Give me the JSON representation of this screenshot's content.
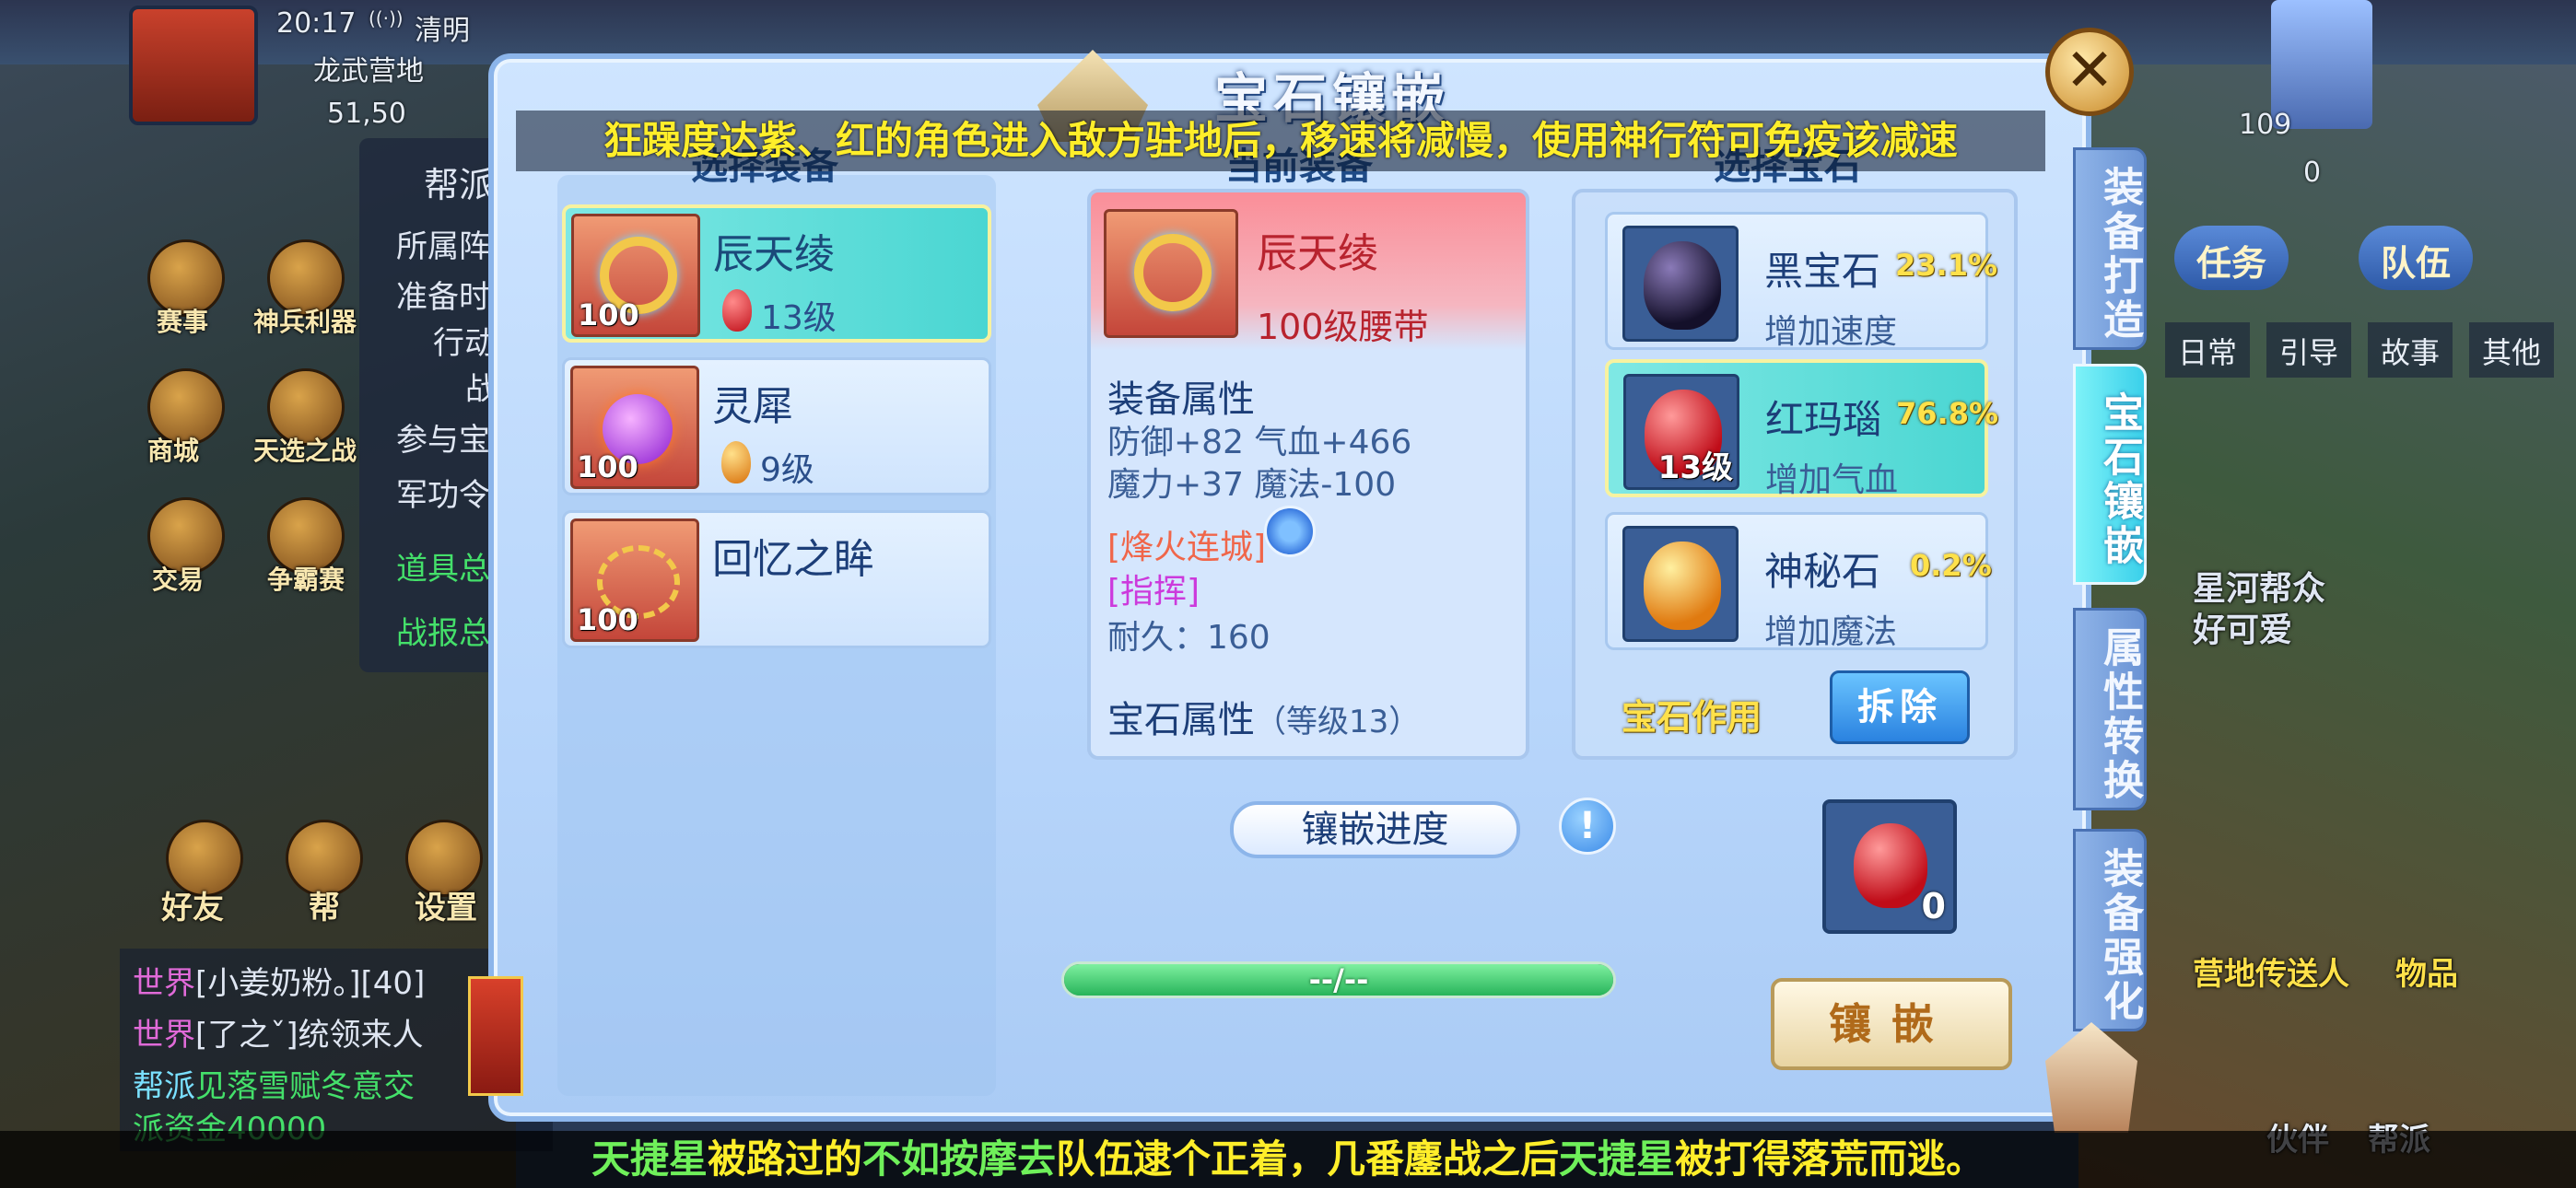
{
  "status_bar": {
    "time": "20:17",
    "weather": "清明",
    "map_name": "龙武营地",
    "coords": "51,50"
  },
  "hud_left": {
    "icons": [
      {
        "label": "赛事",
        "icon": "trophy-icon"
      },
      {
        "label": "神兵利器",
        "icon": "weapon-icon"
      },
      {
        "label": "商城",
        "icon": "shop-icon"
      },
      {
        "label": "天选之战",
        "icon": "battle-icon"
      },
      {
        "label": "交易",
        "icon": "trade-icon"
      },
      {
        "label": "争霸赛",
        "icon": "tournament-icon"
      },
      {
        "label": "好友",
        "icon": "friends-icon"
      },
      {
        "label": "帮",
        "icon": "voice-icon"
      },
      {
        "label": "设置",
        "icon": "gear-icon"
      }
    ],
    "side_panel": {
      "title": "帮派",
      "rows": [
        "所属阵",
        "准备时",
        "行动",
        "战",
        "参与宝",
        "军功令",
        "道具总",
        "战报总"
      ]
    }
  },
  "chat": {
    "lines": [
      {
        "channel": "世界",
        "text": "[小姜奶粉。][40]"
      },
      {
        "channel": "世界",
        "text": "[了之ˇ]统领来人"
      },
      {
        "channel": "帮派",
        "text": "见落雪赋冬意交"
      },
      {
        "channel": "",
        "text": "派资金40000"
      }
    ]
  },
  "hud_right": {
    "level": "109",
    "score": "0",
    "task_button": "任务",
    "team_button": "队伍",
    "tabs": [
      "日常",
      "引导",
      "故事",
      "其他"
    ],
    "overlay_texts": [
      "星河帮众",
      "好可爱",
      "营地传送人",
      "物品"
    ],
    "bottom_labels": [
      "伙伴",
      "帮派"
    ]
  },
  "top_banner": "狂躁度达紫、红的角色进入敌方驻地后，移速将减慢，使用神行符可免疫该减速",
  "bottom_banner": {
    "parts": [
      {
        "text": "天捷星",
        "color": "green"
      },
      {
        "text": "被路过的",
        "color": "yellow"
      },
      {
        "text": "不如按摩去",
        "color": "green"
      },
      {
        "text": "队伍逮个正着，几番鏖战之后",
        "color": "yellow"
      },
      {
        "text": "天捷星",
        "color": "green"
      },
      {
        "text": "被打得落荒而逃。",
        "color": "yellow"
      }
    ]
  },
  "panel": {
    "title": "宝石镶嵌",
    "left_header": "选择装备",
    "middle_header": "当前装备",
    "right_header": "选择宝石",
    "equipment": [
      {
        "name": "辰天绫",
        "level": "100",
        "gem_level": "13级",
        "gem_color": "red",
        "selected": true
      },
      {
        "name": "灵犀",
        "level": "100",
        "gem_level": "9级",
        "gem_color": "orange",
        "selected": false
      },
      {
        "name": "回忆之眸",
        "level": "100",
        "gem_level": "",
        "gem_color": "",
        "selected": false
      }
    ],
    "current": {
      "name": "辰天绫",
      "subtitle": "100级腰带",
      "attr_header": "装备属性",
      "attr_line1": "防御+82 气血+466",
      "attr_line2": "魔力+37 魔法-100",
      "special1": "[烽火连城]",
      "special2": "[指挥]",
      "durability": "耐久：160",
      "gem_header": "宝石属性",
      "gem_header_level": "（等级13）"
    },
    "gems": [
      {
        "name": "黑宝石",
        "rate": "23.1%",
        "desc": "增加速度",
        "type": "black",
        "level": "",
        "selected": false
      },
      {
        "name": "红玛瑙",
        "rate": "76.8%",
        "desc": "增加气血",
        "type": "red",
        "level": "13级",
        "selected": true
      },
      {
        "name": "神秘石",
        "rate": "0.2%",
        "desc": "增加魔法",
        "type": "gold",
        "level": "",
        "selected": false
      }
    ],
    "gem_effect_label": "宝石作用",
    "remove_button": "拆除",
    "progress_label": "镶嵌进度",
    "progress_text": "--/--",
    "progress_value": 1.0,
    "material_count": "0",
    "inlay_button": "镶嵌",
    "side_tabs": [
      {
        "label": "装备打造",
        "active": false
      },
      {
        "label": "宝石镶嵌",
        "active": true
      },
      {
        "label": "属性转换",
        "active": false
      },
      {
        "label": "装备强化",
        "active": false
      }
    ]
  }
}
